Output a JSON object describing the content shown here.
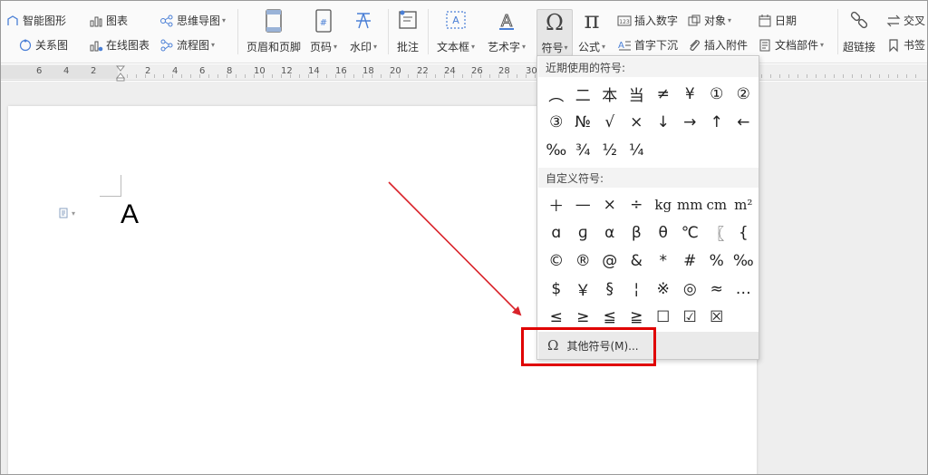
{
  "toolbar": {
    "smart_art": "智能图形",
    "chart": "图表",
    "mind_map": "思维导图",
    "relation": "关系图",
    "online_chart": "在线图表",
    "flowchart": "流程图",
    "header_footer": "页眉和页脚",
    "page_number": "页码",
    "watermark": "水印",
    "comment": "批注",
    "text_box": "文本框",
    "word_art": "艺术字",
    "symbol": "符号",
    "formula": "公式",
    "insert_number": "插入数字",
    "object": "对象",
    "date": "日期",
    "drop_cap": "首字下沉",
    "attachment": "插入附件",
    "doc_parts": "文档部件",
    "hyperlink": "超链接",
    "cross_ref": "交叉",
    "bookmark": "书签"
  },
  "ruler": {
    "numbers": [
      "6",
      "4",
      "2",
      "2",
      "4",
      "6",
      "8",
      "10",
      "12",
      "14",
      "16",
      "18",
      "20",
      "22",
      "24",
      "26",
      "28",
      "30",
      "32"
    ]
  },
  "document": {
    "text": "A"
  },
  "symbol_menu": {
    "recent_header": "近期使用的符号:",
    "recent": [
      "︵",
      "二",
      "本",
      "当",
      "≠",
      "¥",
      "①",
      "②",
      "③",
      "№",
      "√",
      "×",
      "↓",
      "→",
      "↑",
      "←",
      "‰",
      "¾",
      "½",
      "¼"
    ],
    "custom_header": "自定义符号:",
    "custom": [
      "＋",
      "—",
      "×",
      "÷",
      "kg",
      "mm",
      "cm",
      "m²",
      "ɑ",
      "ɡ",
      "α",
      "β",
      "θ",
      "℃",
      "〖",
      "{",
      "©",
      "®",
      "@",
      "&",
      "*",
      "#",
      "%",
      "‰",
      "$",
      "￥",
      "§",
      "¦",
      "※",
      "◎",
      "≈",
      "…",
      "≤",
      "≥",
      "≦",
      "≧",
      "☐",
      "☑",
      "☒"
    ],
    "more_label": "其他符号(M)..."
  },
  "colors": {
    "highlight": "#e00000",
    "arrow": "#d9232a"
  }
}
